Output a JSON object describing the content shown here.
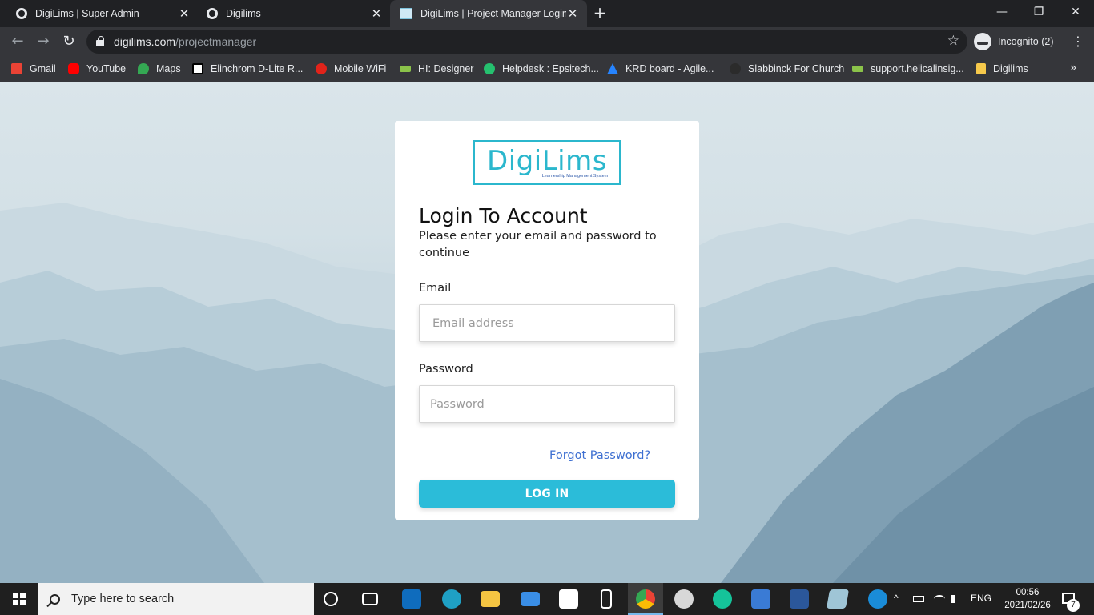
{
  "browser": {
    "tabs": [
      {
        "title": "DigiLims | Super Admin",
        "active": false
      },
      {
        "title": "Digilims",
        "active": false
      },
      {
        "title": "DigiLims | Project Manager Login",
        "active": true
      }
    ],
    "tab_close_glyph": "✕",
    "new_tab_glyph": "+",
    "window_controls": {
      "minimize": "—",
      "maximize": "❐",
      "close": "✕"
    },
    "url": {
      "domain": "digilims.com",
      "path": "/projectmanager"
    },
    "profile_label": "Incognito (2)",
    "nav": {
      "back": "←",
      "forward": "→",
      "reload": "↻"
    },
    "star_glyph": "☆",
    "menu_glyph": "⋮",
    "bookmarks": [
      {
        "label": "Gmail",
        "icon": "gmail-icon",
        "color": "#ea4335"
      },
      {
        "label": "YouTube",
        "icon": "youtube-icon",
        "color": "#ff0000"
      },
      {
        "label": "Maps",
        "icon": "maps-icon",
        "color": "#34a853"
      },
      {
        "label": "Elinchrom D-Lite R...",
        "icon": "elinchrom-icon",
        "color": "#ffffff"
      },
      {
        "label": "Mobile WiFi",
        "icon": "huawei-icon",
        "color": "#e2231a"
      },
      {
        "label": "HI: Designer",
        "icon": "hi-designer-icon",
        "color": "#8bc34a"
      },
      {
        "label": "Helpdesk : Epsitech...",
        "icon": "helpdesk-icon",
        "color": "#25c16f"
      },
      {
        "label": "KRD board - Agile...",
        "icon": "jira-icon",
        "color": "#2684ff"
      },
      {
        "label": "Slabbinck For Church",
        "icon": "slabbinck-icon",
        "color": "#444444"
      },
      {
        "label": "support.helicalinsig...",
        "icon": "helical-icon",
        "color": "#8bc34a"
      },
      {
        "label": "Digilims",
        "icon": "folder-icon",
        "color": "#f6c94b"
      }
    ],
    "bookmarks_more": "»"
  },
  "login": {
    "logo_text": "DigiLims",
    "logo_subtitle": "Learnership Management System",
    "title": "Login To Account",
    "subtitle": "Please enter your email and password to continue",
    "email_label": "Email",
    "email_placeholder": "Email address",
    "password_label": "Password",
    "password_placeholder": "Password",
    "forgot_link": "Forgot Password?",
    "login_button": "LOG IN",
    "accent_color": "#2bbcd9",
    "link_color": "#3d6fd1"
  },
  "taskbar": {
    "search_placeholder": "Type here to search",
    "apps": [
      "cortana-icon",
      "task-view-icon",
      "outlook-icon",
      "edge-icon",
      "file-explorer-icon",
      "mail-icon",
      "amazon-icon",
      "app-s-icon",
      "chrome-icon",
      "paint-icon",
      "grammarly-icon",
      "network-tool-icon",
      "word-icon",
      "notes-icon",
      "help-icon"
    ],
    "tray": {
      "language": "ENG",
      "chevron": "^"
    },
    "clock": {
      "time": "00:56",
      "date": "2021/02/26"
    },
    "notifications_count": "7"
  }
}
